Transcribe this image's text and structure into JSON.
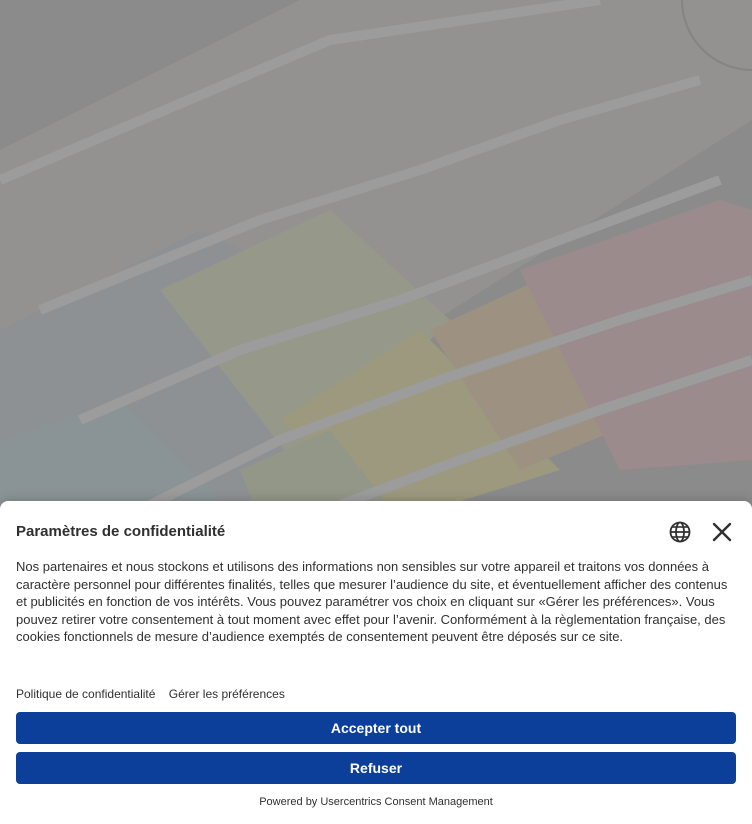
{
  "banner": {
    "title": "Paramètres de confidentialité",
    "description": "Nos partenaires et nous stockons et utilisons des informations non sensibles sur votre appareil et traitons vos données à caractère personnel pour différentes finalités, telles que mesurer l’audience du site, et éventuellement afficher des contenus et publicités en fonction de vos intérêts. Vous pouvez paramétrer vos choix en cliquant sur «Gérer les préférences». Vous pouvez retirer votre consentement à tout moment avec effet pour l’avenir. Conformément à la règlementation française, des cookies fonctionnels de mesure d’audience exemptés de consentement peuvent être déposés sur ce site.",
    "links": {
      "privacy_policy": "Politique de confidentialité",
      "manage_preferences": "Gérer les préférences"
    },
    "buttons": {
      "accept_all": "Accepter tout",
      "deny": "Refuser"
    },
    "powered_by": "Powered by Usercentrics Consent Management",
    "icons": {
      "language": "globe-icon",
      "close": "close-icon"
    },
    "colors": {
      "primary": "#0b3f99",
      "text": "#303030",
      "background": "#ffffff"
    }
  }
}
